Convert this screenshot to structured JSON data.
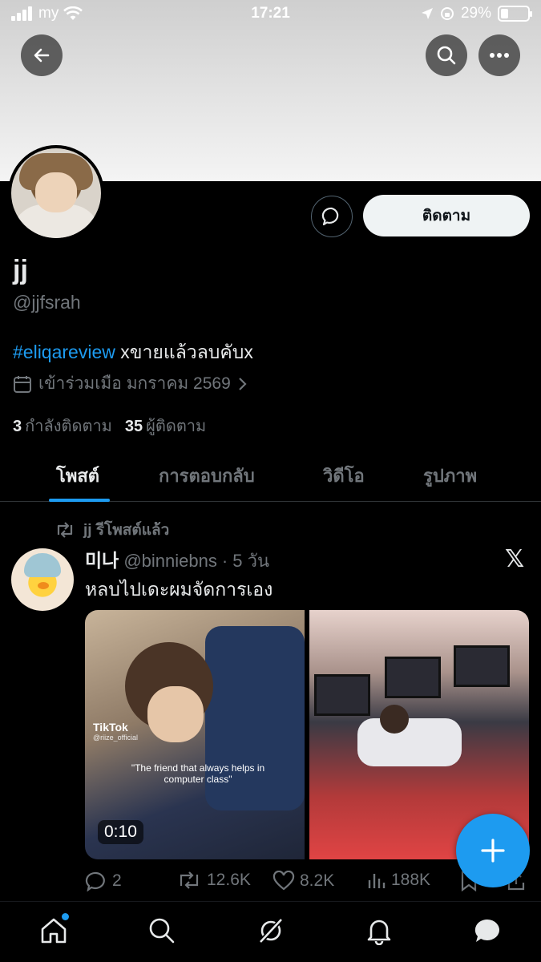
{
  "status_bar": {
    "carrier": "my",
    "time": "17:21",
    "battery": "29%",
    "battery_level": 0.29
  },
  "header": {
    "back_icon": "arrow-left-icon",
    "search_icon": "search-icon",
    "more_icon": "more-horizontal-icon"
  },
  "profile": {
    "name": "jj",
    "handle": "@jjfsrah",
    "bio_hashtag": "#eliqareview",
    "bio_text": " xขายแล้วลบคับx",
    "joined": "เข้าร่วมเมือ มกราคม 2569",
    "following_count": "3",
    "following_label": "กำลังติดตาม",
    "followers_count": "35",
    "followers_label": "ผู้ติดตาม",
    "follow_button": "ติดตาม"
  },
  "tabs": [
    "โพสต์",
    "การตอบกลับ",
    "วิดีโอ",
    "รูปภาพ"
  ],
  "post": {
    "repost_label": "jj รีโพสต์แล้ว",
    "author": "미나",
    "handle": "@binniebns",
    "time": "· 5 วัน",
    "text": "หลบไปเดะผมจัดการเอง",
    "media": {
      "tiktok_label": "TikTok",
      "tiktok_handle": "@riize_official",
      "caption": "\"The friend that always helps in computer class\"",
      "duration": "0:10"
    },
    "actions": {
      "replies": "2",
      "reposts": "12.6K",
      "likes": "8.2K",
      "views": "188K"
    }
  },
  "colors": {
    "accent": "#1d9bf0",
    "background": "#000000",
    "muted": "#71767b"
  }
}
